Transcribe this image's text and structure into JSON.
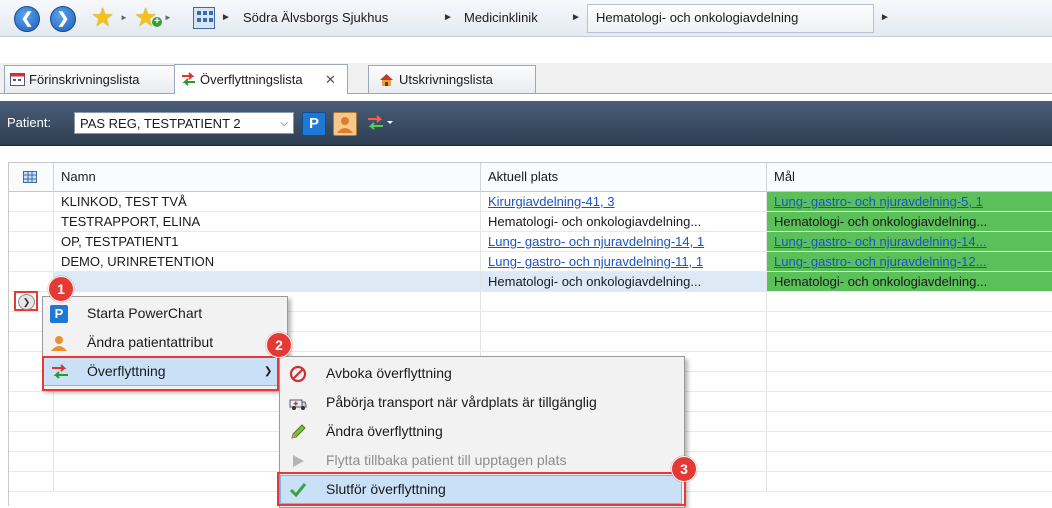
{
  "breadcrumb": {
    "items": [
      "Södra Älvsborgs Sjukhus",
      "Medicinklinik",
      "Hematologi- och onkologiavdelning"
    ],
    "separator": "►"
  },
  "tabs": [
    {
      "label": "Förinskrivningslista"
    },
    {
      "label": "Överflyttningslista",
      "close": "✕"
    },
    {
      "label": "Utskrivningslista"
    }
  ],
  "patient_bar": {
    "label": "Patient:",
    "selected": "PAS REG, TESTPATIENT 2"
  },
  "grid": {
    "columns": [
      "Namn",
      "Aktuell plats",
      "Mål"
    ],
    "rows": [
      {
        "namn": "KLINKOD, TEST TVÅ",
        "plats": "Kirurgiavdelning-41, 3",
        "mal": "Lung- gastro- och njuravdelning-5, 1",
        "plats_link": true,
        "mal_link": true
      },
      {
        "namn": "TESTRAPPORT, ELINA",
        "plats": "Hematologi- och onkologiavdelning...",
        "mal": "Hematologi- och onkologiavdelning...",
        "plats_link": false,
        "mal_link": false
      },
      {
        "namn": "OP, TESTPATIENT1",
        "plats": "Lung- gastro- och njuravdelning-14, 1",
        "mal": "Lung- gastro- och njuravdelning-14...",
        "plats_link": true,
        "mal_link": true
      },
      {
        "namn": "DEMO, URINRETENTION",
        "plats": "Lung- gastro- och njuravdelning-11, 1",
        "mal": "Lung- gastro- och njuravdelning-12...",
        "plats_link": true,
        "mal_link": true
      },
      {
        "namn": "",
        "plats": "Hematologi- och onkologiavdelning...",
        "mal": "Hematologi- och onkologiavdelning...",
        "plats_link": false,
        "mal_link": false
      }
    ]
  },
  "context_menu": {
    "items": [
      "Starta PowerChart",
      "Ändra patientattribut",
      "Överflyttning"
    ]
  },
  "submenu": {
    "items": [
      {
        "label": "Avboka överflyttning",
        "icon": "cancel-icon"
      },
      {
        "label": "Påbörja transport när vårdplats är tillgänglig",
        "icon": "ambulance-icon"
      },
      {
        "label": "Ändra överflyttning",
        "icon": "pencil-icon"
      },
      {
        "label": "Flytta tillbaka patient till upptagen plats",
        "icon": "play-icon",
        "disabled": true
      },
      {
        "label": "Slutför överflyttning",
        "icon": "checkmark-icon"
      }
    ]
  },
  "callouts": [
    "1",
    "2",
    "3"
  ],
  "colors": {
    "accent_red": "#e53935",
    "green": "#5bbf5a",
    "link": "#1a54c4",
    "toolbar": "#3a4c64"
  }
}
